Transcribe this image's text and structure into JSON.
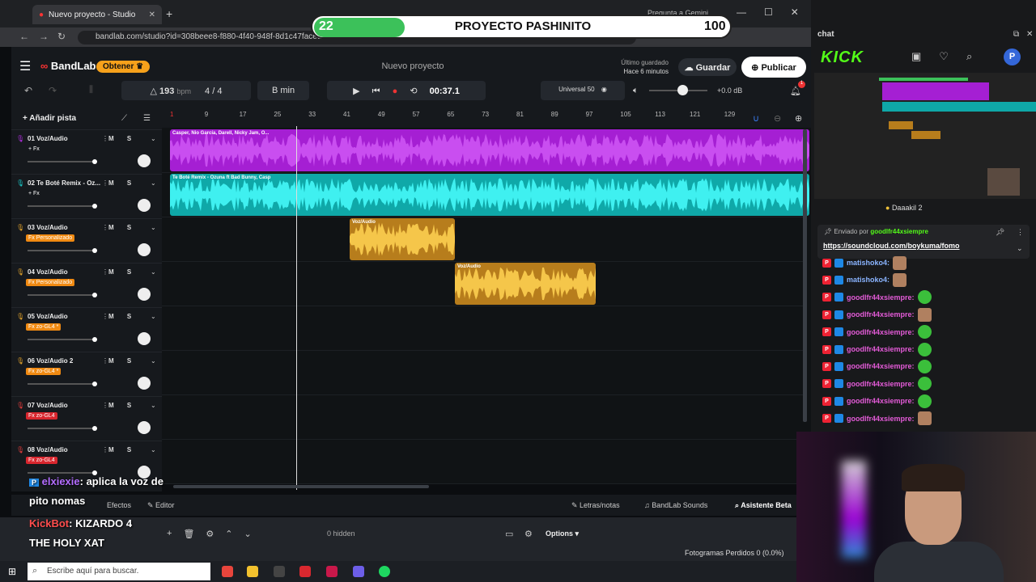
{
  "browser": {
    "tab_title": "Nuevo proyecto - Studio",
    "url": "bandlab.com/studio?id=308beee8-f880-4f40-948f-8d1c47facedc",
    "ask_gemini": "Pregunta a Gemini"
  },
  "score_overlay": {
    "left_score": "22",
    "title": "PROYECTO PASHINITO",
    "right_score": "100"
  },
  "header": {
    "logo": "BandLab",
    "upgrade_label": "Obtener ♛",
    "project_name": "Nuevo proyecto",
    "saved_label": "Último guardado",
    "saved_time": "Hace 6 minutos",
    "save_label": "Guardar",
    "publish_label": "Publicar"
  },
  "transport": {
    "bpm": "193",
    "bpm_unit": "bpm",
    "time_signature": "4 / 4",
    "key": "B min",
    "timecode": "00:37.1",
    "universal_label": "Universal",
    "universal_value": "50",
    "master_db": "+0.0 dB",
    "master_volume_fraction": 0.5,
    "notification_count": "1"
  },
  "add_track_label": "Añadir pista",
  "ruler_ticks": [
    "1",
    "9",
    "17",
    "25",
    "33",
    "41",
    "49",
    "57",
    "65",
    "73",
    "81",
    "89",
    "97",
    "105",
    "113",
    "121",
    "129"
  ],
  "tracks": [
    {
      "name": "01 Voz/Audio",
      "fx": "+ Fx",
      "fx_style": "plain",
      "color": "#b12de0"
    },
    {
      "name": "02 Te Boté Remix - Oz...",
      "fx": "+ Fx",
      "fx_style": "plain",
      "color": "#19c6c6"
    },
    {
      "name": "03 Voz/Audio",
      "fx": "Fx Personalizado",
      "fx_style": "orange",
      "color": "#e0a12a"
    },
    {
      "name": "04 Voz/Audio",
      "fx": "Fx Personalizado",
      "fx_style": "orange",
      "color": "#e0a12a"
    },
    {
      "name": "05 Voz/Audio",
      "fx": "Fx zo-GL4 *",
      "fx_style": "orange",
      "color": "#e0a12a"
    },
    {
      "name": "06 Voz/Audio 2",
      "fx": "Fx zo-GL4 *",
      "fx_style": "orange",
      "color": "#e0a12a"
    },
    {
      "name": "07 Voz/Audio",
      "fx": "Fx zo-GL4",
      "fx_style": "red",
      "color": "#e23b3b"
    },
    {
      "name": "08 Voz/Audio",
      "fx": "Fx zo-GL4",
      "fx_style": "red",
      "color": "#e23b3b"
    }
  ],
  "mute_solo": "M S",
  "clips": {
    "clip1": "Casper, Nio García, Darell, Nicky Jam, O...",
    "clip2": "Te Boté Remix - Ozuna ft Bad Bunny, Casp",
    "clip3": "Voz/Audio",
    "clip4": "Voz/Audio"
  },
  "bottom_bar": {
    "effects": "Efectos",
    "editor": "Editor",
    "lyrics": "Letras/notas",
    "sounds": "BandLab Sounds",
    "assistant": "Asistente",
    "beta": "Beta"
  },
  "obs": {
    "hidden": "0 hidden",
    "options": "Options",
    "frames": "Fotogramas Perdidos 0 (0.0%)"
  },
  "overlay_chat": {
    "user1": "elxiexie",
    "msg1": ": aplica la voz de",
    "msg1b": "pito nomas",
    "user2": "KickBot",
    "msg2": ": KIZARDO 4",
    "msg2b": "THE HOLY XAT"
  },
  "taskbar": {
    "search_placeholder": "Escribe aquí para buscar."
  },
  "chat": {
    "panel_title": "chat",
    "brand": "KICK",
    "avatar_letter": "P",
    "top_user": "Daaakil",
    "top_user_count": "2",
    "pinned_by": "Enviado por",
    "pinned_user": "goodlfr44xsiempre",
    "pinned_link": "https://soundcloud.com/boykuma/fomo",
    "messages": [
      {
        "user": "matishoko4:",
        "color": "#8ab4ff",
        "emote": "cat"
      },
      {
        "user": "matishoko4:",
        "color": "#8ab4ff",
        "emote": "cat"
      },
      {
        "user": "goodlfr44xsiempre:",
        "color": "#e45bd8",
        "emote": "green"
      },
      {
        "user": "goodlfr44xsiempre:",
        "color": "#e45bd8",
        "emote": "cat"
      },
      {
        "user": "goodlfr44xsiempre:",
        "color": "#e45bd8",
        "emote": "green"
      },
      {
        "user": "goodlfr44xsiempre:",
        "color": "#e45bd8",
        "emote": "green"
      },
      {
        "user": "goodlfr44xsiempre:",
        "color": "#e45bd8",
        "emote": "green"
      },
      {
        "user": "goodlfr44xsiempre:",
        "color": "#e45bd8",
        "emote": "green"
      },
      {
        "user": "goodlfr44xsiempre:",
        "color": "#e45bd8",
        "emote": "green"
      },
      {
        "user": "goodlfr44xsiempre:",
        "color": "#e45bd8",
        "emote": "cat"
      }
    ]
  }
}
